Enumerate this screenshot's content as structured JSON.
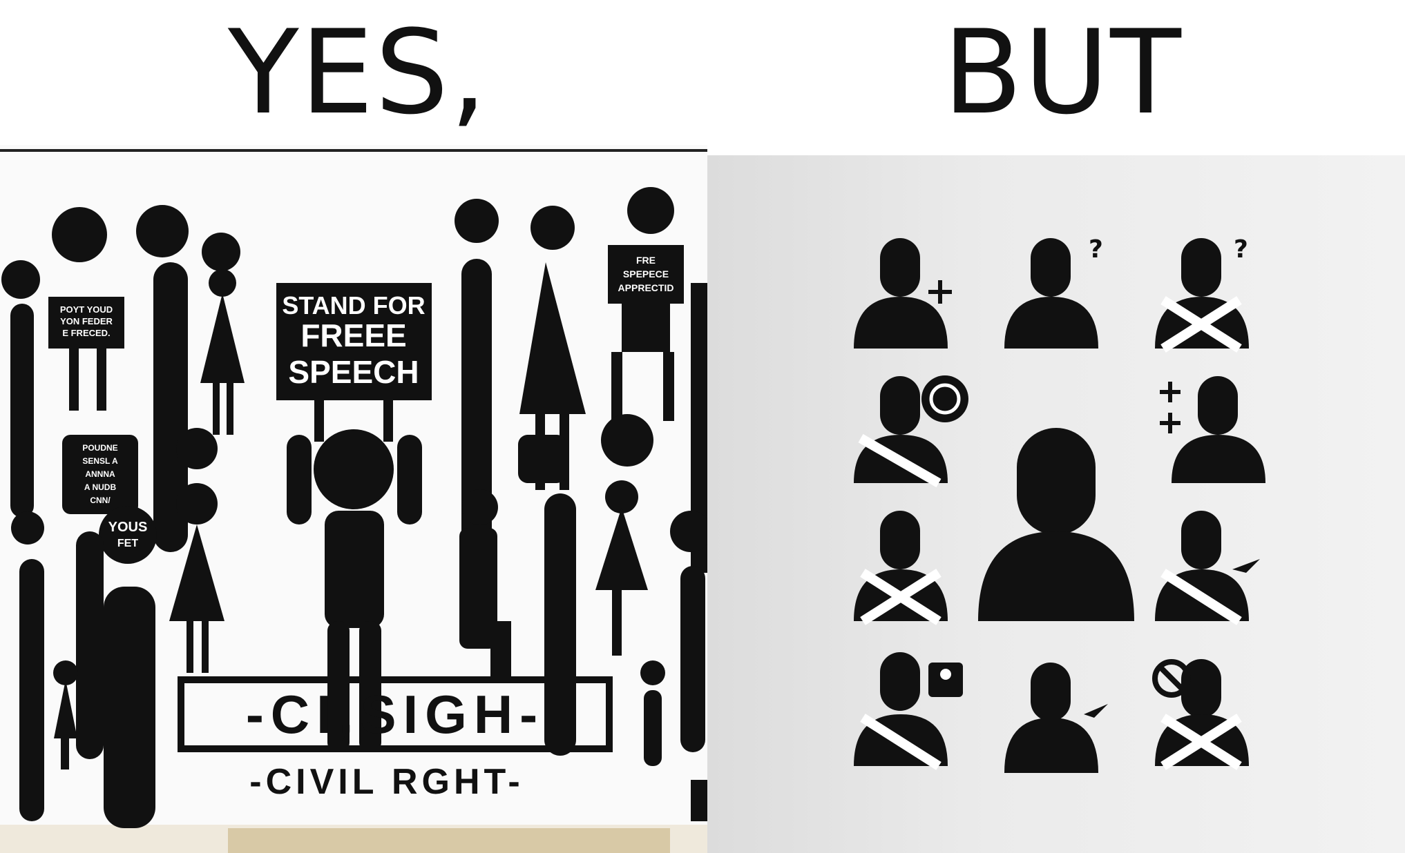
{
  "captions": {
    "left": "YES,",
    "right": "BUT"
  },
  "left_panel": {
    "main_sign_lines": [
      "STAND FOR",
      "FREEE",
      "SPEECH"
    ],
    "small_sign_1": [
      "POYT YOUD",
      "YON FEDER",
      "E FRECED."
    ],
    "small_sign_2": [
      "FRE",
      "SPEPECE",
      "APPRECTID"
    ],
    "small_sign_3": [
      "POUDNE",
      "SENSL A",
      "ANNNA",
      "A NUDB",
      "CNN/"
    ],
    "bubble_text": [
      "YOUS",
      "FET"
    ],
    "banner_text": "-CI,SIGH-",
    "banner_subtext": "-CIVIL RGHT-"
  },
  "right_panel": {
    "icons": [
      "person-plus-icon",
      "person-question-icon",
      "person-seatbelt-question-icon",
      "person-seatbelt-no-sign-icon",
      "person-large-icon",
      "person-plus-plus-icon",
      "person-seatbelt-icon",
      "person-seatbelt-plane-icon",
      "person-seatbelt-contact-icon",
      "person-plane-icon",
      "person-seatbelt-ban-icon"
    ]
  }
}
